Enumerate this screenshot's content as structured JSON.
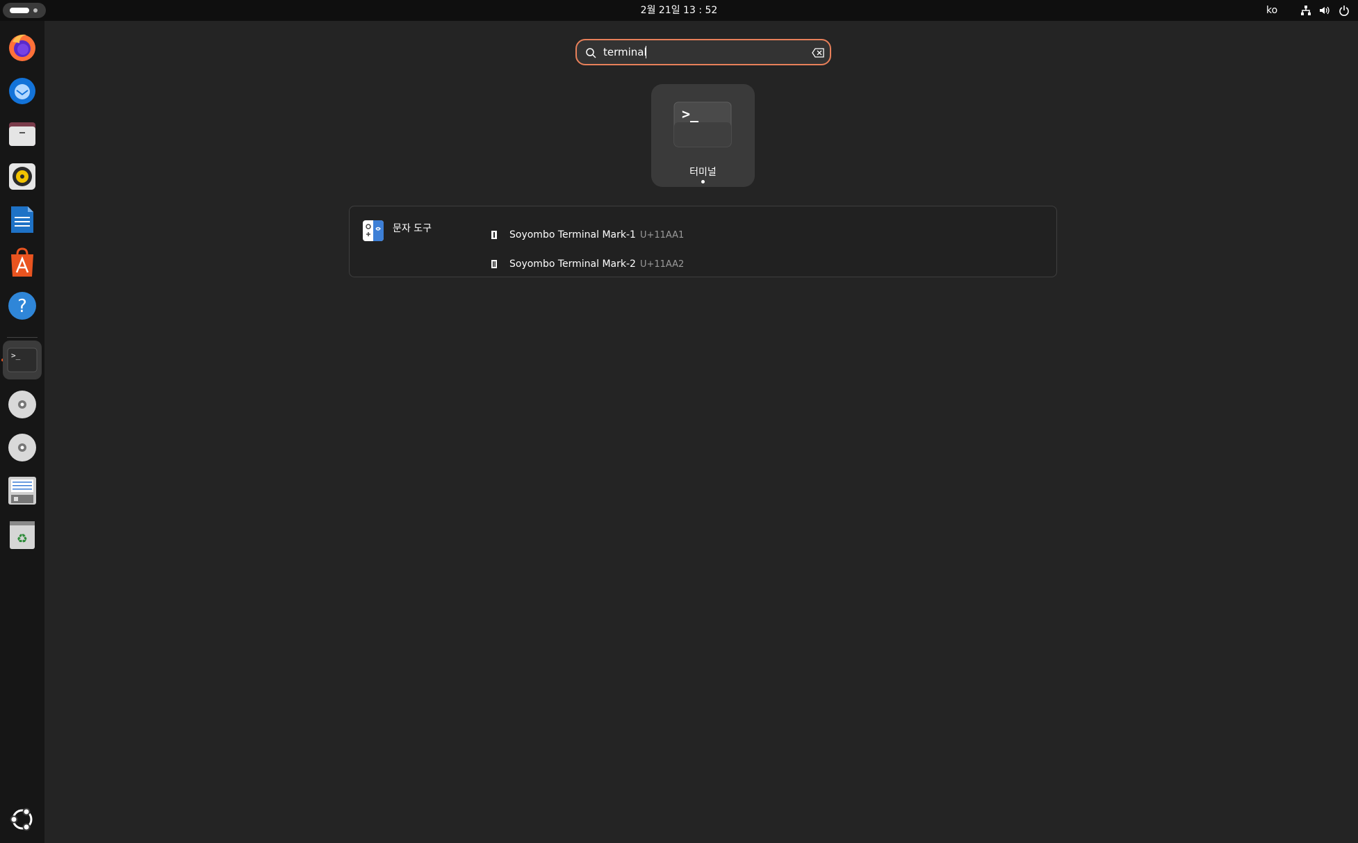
{
  "topbar": {
    "clock": "2월 21일  13 : 52",
    "language": "ko",
    "tray_icons": [
      "network-icon",
      "volume-icon",
      "power-icon"
    ]
  },
  "dock": {
    "apps": [
      {
        "name": "firefox",
        "icon": "firefox-icon"
      },
      {
        "name": "thunderbird",
        "icon": "thunderbird-icon"
      },
      {
        "name": "files",
        "icon": "files-icon"
      },
      {
        "name": "rhythmbox",
        "icon": "rhythmbox-icon"
      },
      {
        "name": "libreoffice-writer",
        "icon": "writer-icon"
      },
      {
        "name": "app-center",
        "icon": "app-center-icon"
      },
      {
        "name": "help",
        "icon": "help-icon"
      },
      {
        "name": "terminal",
        "icon": "terminal-icon",
        "running": true
      },
      {
        "name": "disc-1",
        "icon": "disc-icon"
      },
      {
        "name": "disc-2",
        "icon": "disc-icon"
      },
      {
        "name": "text-editor",
        "icon": "document-icon"
      },
      {
        "name": "trash",
        "icon": "trash-icon"
      }
    ],
    "show_apps_icon": "ubuntu-grid-icon"
  },
  "search": {
    "value": "terminal",
    "placeholder": ""
  },
  "app_results": [
    {
      "label": "터미널",
      "icon": "terminal-icon"
    }
  ],
  "provider": {
    "name": "문자 도구",
    "icon": "characters-icon",
    "results": [
      {
        "name": "Soyombo Terminal Mark-1",
        "code": "U+11AA1"
      },
      {
        "name": "Soyombo Terminal Mark-2",
        "code": "U+11AA2"
      }
    ]
  },
  "colors": {
    "accent": "#e8805a",
    "running_indicator": "#e95420",
    "background": "#242424"
  }
}
